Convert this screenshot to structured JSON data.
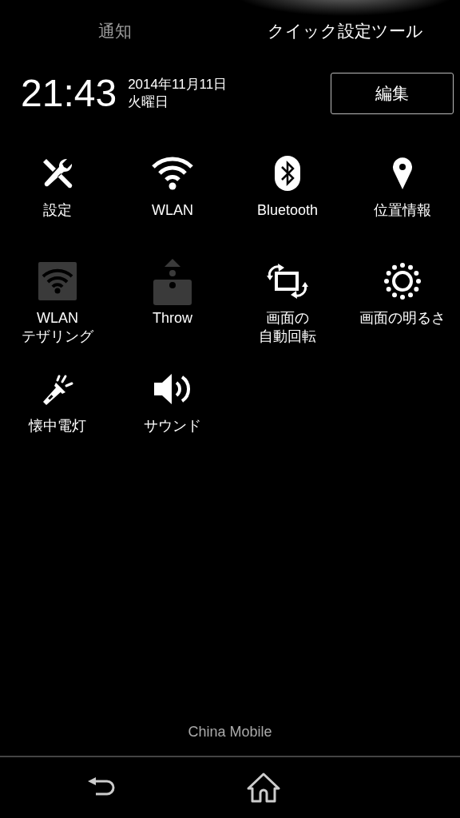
{
  "tabs": [
    {
      "label": "通知",
      "selected": false
    },
    {
      "label": "クイック設定ツール",
      "selected": true
    }
  ],
  "clock": {
    "time": "21:43",
    "date": "2014年11月11日",
    "weekday": "火曜日"
  },
  "edit_button": {
    "label": "編集"
  },
  "tiles": [
    {
      "kind": "settings",
      "label": [
        "設定"
      ],
      "disabled": false
    },
    {
      "kind": "wifi",
      "label": [
        "WLAN"
      ],
      "disabled": false
    },
    {
      "kind": "bluetooth",
      "label": [
        "Bluetooth"
      ],
      "disabled": false
    },
    {
      "kind": "location",
      "label": [
        "位置情報"
      ],
      "disabled": false
    },
    {
      "kind": "tethering",
      "label": [
        "WLAN",
        "テザリング"
      ],
      "disabled": true
    },
    {
      "kind": "throw",
      "label": [
        "Throw"
      ],
      "disabled": true
    },
    {
      "kind": "rotate",
      "label": [
        "画面の",
        "自動回転"
      ],
      "disabled": false
    },
    {
      "kind": "brightness",
      "label": [
        "画面の明るさ"
      ],
      "disabled": false
    },
    {
      "kind": "flashlight",
      "label": [
        "懐中電灯"
      ],
      "disabled": false
    },
    {
      "kind": "sound",
      "label": [
        "サウンド"
      ],
      "disabled": false
    }
  ],
  "carrier": "China Mobile",
  "nav_bar": {
    "buttons": [
      {
        "kind": "back"
      },
      {
        "kind": "home"
      }
    ]
  }
}
